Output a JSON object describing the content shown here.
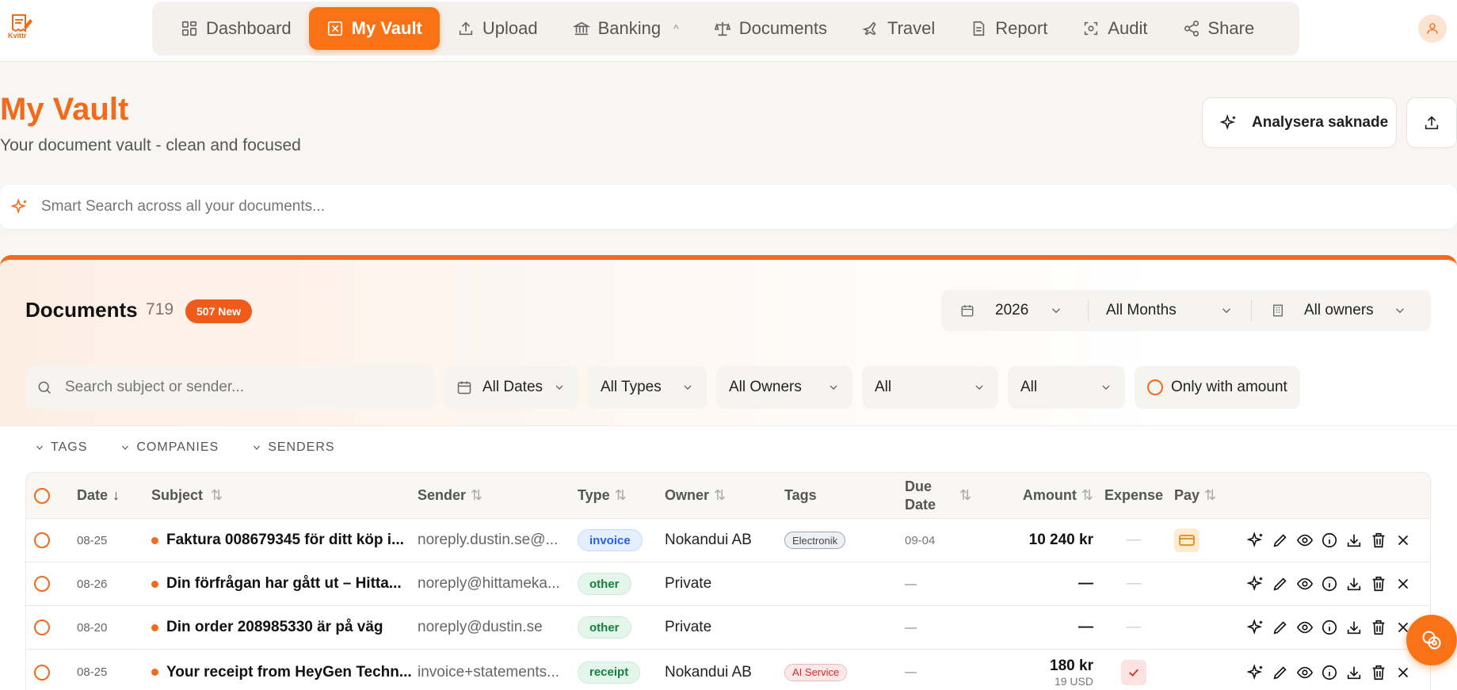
{
  "app": {
    "logo_text": "Kvittr"
  },
  "nav": {
    "items": [
      {
        "label": "Dashboard",
        "icon": "dashboard-icon"
      },
      {
        "label": "My Vault",
        "icon": "vault-icon",
        "active": true
      },
      {
        "label": "Upload",
        "icon": "upload-icon"
      },
      {
        "label": "Banking",
        "icon": "bank-icon",
        "caret": "^"
      },
      {
        "label": "Documents",
        "icon": "scale-icon"
      },
      {
        "label": "Travel",
        "icon": "plane-icon"
      },
      {
        "label": "Report",
        "icon": "report-icon"
      },
      {
        "label": "Audit",
        "icon": "scan-icon"
      },
      {
        "label": "Share",
        "icon": "share-icon"
      }
    ]
  },
  "header": {
    "title": "My Vault",
    "subtitle": "Your document vault - clean and focused",
    "analyse_label": "Analysera saknade"
  },
  "smart_search": {
    "placeholder": "Smart Search across all your documents..."
  },
  "documents": {
    "title": "Documents",
    "count": "719",
    "new_badge": "507 New",
    "period": {
      "year": "2026",
      "months": "All Months",
      "owners": "All owners"
    },
    "filters": {
      "search_placeholder": "Search subject or sender...",
      "dates": "All Dates",
      "types": "All Types",
      "owners": "All Owners",
      "filter4": "All",
      "filter5": "All",
      "only_amount": "Only with amount"
    },
    "groups": [
      "TAGS",
      "COMPANIES",
      "SENDERS"
    ],
    "columns": {
      "date": "Date",
      "subject": "Subject",
      "sender": "Sender",
      "type": "Type",
      "owner": "Owner",
      "tags": "Tags",
      "due_date_1": "Due",
      "due_date_2": "Date",
      "amount": "Amount",
      "expense": "Expense",
      "pay": "Pay"
    },
    "rows": [
      {
        "date": "08-25",
        "subject": "Faktura 008679345 för ditt köp i...",
        "sender": "noreply.dustin.se@...",
        "type": "invoice",
        "owner": "Nokandui AB",
        "tag": "Electronik",
        "due": "09-04",
        "amount": "10 240 kr",
        "amount_sub": "",
        "expense": "—"
      },
      {
        "date": "08-26",
        "subject": "Din förfrågan har gått ut – Hitta...",
        "sender": "noreply@hittameka...",
        "type": "other",
        "owner": "Private",
        "tag": "",
        "due": "—",
        "amount": "—",
        "amount_sub": "",
        "expense": "—"
      },
      {
        "date": "08-20",
        "subject": "Din order 208985330 är på väg",
        "sender": "noreply@dustin.se",
        "type": "other",
        "owner": "Private",
        "tag": "",
        "due": "—",
        "amount": "—",
        "amount_sub": "",
        "expense": "—"
      },
      {
        "date": "08-25",
        "subject": "Your receipt from HeyGen Techn...",
        "sender": "invoice+statements...",
        "type": "receipt",
        "owner": "Nokandui AB",
        "tag": "AI Service",
        "due": "—",
        "amount": "180 kr",
        "amount_sub": "19 USD",
        "expense": ""
      }
    ]
  },
  "colors": {
    "accent": "#f97316",
    "brand": "#f26a1b"
  }
}
